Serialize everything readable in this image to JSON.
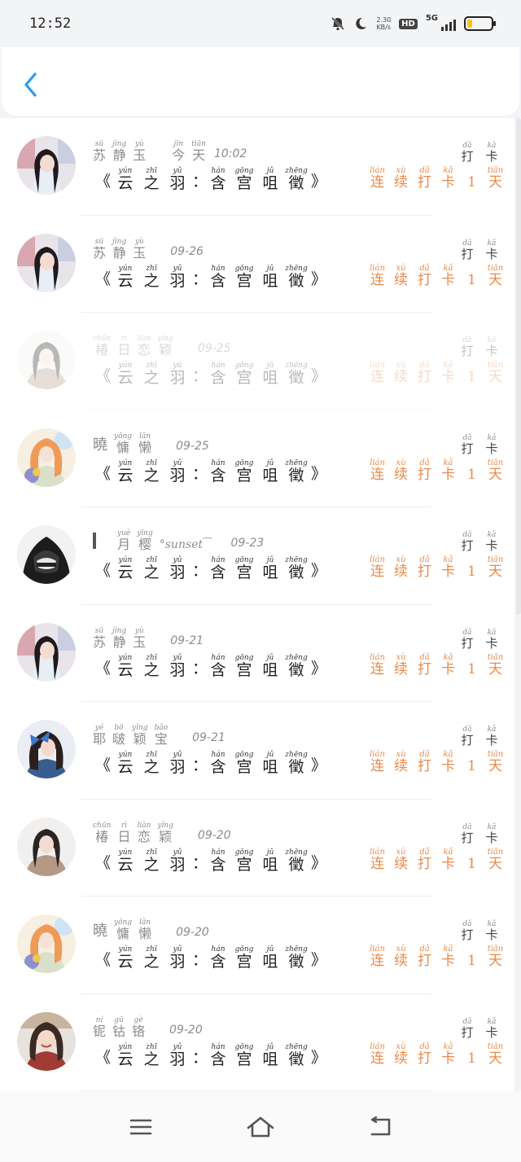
{
  "status": {
    "time": "12:52",
    "net_speed_value": "2.30",
    "net_speed_unit": "KB/s",
    "hd": "HD",
    "network": "5G",
    "battery_percent": 20,
    "icons": [
      "mute-bell-icon",
      "moon-icon",
      "signal-icon",
      "battery-icon"
    ]
  },
  "header": {
    "back_icon": "chevron-left-icon",
    "accent": "#2b9be8"
  },
  "punch": [
    {
      "py": "dǎ",
      "hz": "打"
    },
    {
      "py": "kǎ",
      "hz": "卡"
    }
  ],
  "streak": [
    {
      "py": "lián",
      "hz": "连"
    },
    {
      "py": "xù",
      "hz": "续"
    },
    {
      "py": "dǎ",
      "hz": "打"
    },
    {
      "py": "kǎ",
      "hz": "卡"
    },
    {
      "py": "",
      "hz": "1"
    },
    {
      "py": "tiān",
      "hz": "天"
    }
  ],
  "title": {
    "open": "《",
    "part1": [
      {
        "py": "yún",
        "hz": "云"
      },
      {
        "py": "zhī",
        "hz": "之"
      },
      {
        "py": "yǔ",
        "hz": "羽"
      }
    ],
    "colon": "：",
    "part2": [
      {
        "py": "hán",
        "hz": "含"
      },
      {
        "py": "gōng",
        "hz": "宫"
      },
      {
        "py": "jǔ",
        "hz": "咀"
      },
      {
        "py": "zhēng",
        "hz": "徵"
      }
    ],
    "close": "》"
  },
  "rows": [
    {
      "name": [
        {
          "py": "sū",
          "hz": "苏"
        },
        {
          "py": "jìng",
          "hz": "静"
        },
        {
          "py": "yù",
          "hz": "玉"
        }
      ],
      "date_ruby": [
        {
          "py": "jīn",
          "hz": "今"
        },
        {
          "py": "tiān",
          "hz": "天"
        }
      ],
      "time": "10:02",
      "avatar": "girl-dark-hair"
    },
    {
      "name": [
        {
          "py": "sū",
          "hz": "苏"
        },
        {
          "py": "jìng",
          "hz": "静"
        },
        {
          "py": "yù",
          "hz": "玉"
        }
      ],
      "time": "09-26",
      "avatar": "girl-dark-hair"
    },
    {
      "name": [
        {
          "py": "chūn",
          "hz": "椿"
        },
        {
          "py": "rì",
          "hz": "日"
        },
        {
          "py": "liàn",
          "hz": "恋"
        },
        {
          "py": "yǐng",
          "hz": "颖"
        }
      ],
      "time": "09-25",
      "avatar": "girl-sweater",
      "faded": true
    },
    {
      "name_prefix": "曉",
      "name": [
        {
          "py": "yōng",
          "hz": "慵"
        },
        {
          "py": "lǎn",
          "hz": "懒"
        }
      ],
      "time": "09-25",
      "avatar": "girl-orange-hair"
    },
    {
      "name_bar": true,
      "name": [
        {
          "py": "yuè",
          "hz": "月"
        },
        {
          "py": "yīng",
          "hz": "樱"
        }
      ],
      "name_suffix": "°sunset ͡",
      "time": "09-23",
      "avatar": "hooded-figure"
    },
    {
      "name": [
        {
          "py": "sū",
          "hz": "苏"
        },
        {
          "py": "jìng",
          "hz": "静"
        },
        {
          "py": "yù",
          "hz": "玉"
        }
      ],
      "time": "09-21",
      "avatar": "girl-dark-hair"
    },
    {
      "name": [
        {
          "py": "yé",
          "hz": "耶"
        },
        {
          "py": "bō",
          "hz": "啵"
        },
        {
          "py": "yǐng",
          "hz": "颖"
        },
        {
          "py": "bǎo",
          "hz": "宝"
        }
      ],
      "time": "09-21",
      "avatar": "girl-blue-bow"
    },
    {
      "name": [
        {
          "py": "chūn",
          "hz": "椿"
        },
        {
          "py": "rì",
          "hz": "日"
        },
        {
          "py": "liàn",
          "hz": "恋"
        },
        {
          "py": "yǐng",
          "hz": "颖"
        }
      ],
      "time": "09-20",
      "avatar": "girl-sweater"
    },
    {
      "name_prefix": "曉",
      "name": [
        {
          "py": "yōng",
          "hz": "慵"
        },
        {
          "py": "lǎn",
          "hz": "懒"
        }
      ],
      "time": "09-20",
      "avatar": "girl-orange-hair"
    },
    {
      "name": [
        {
          "py": "ní",
          "hz": "铌"
        },
        {
          "py": "gū",
          "hz": "钴"
        },
        {
          "py": "gè",
          "hz": "铬"
        }
      ],
      "time": "09-20",
      "avatar": "girl-smiling"
    }
  ],
  "nav": [
    "menu-icon",
    "home-icon",
    "back-icon"
  ]
}
